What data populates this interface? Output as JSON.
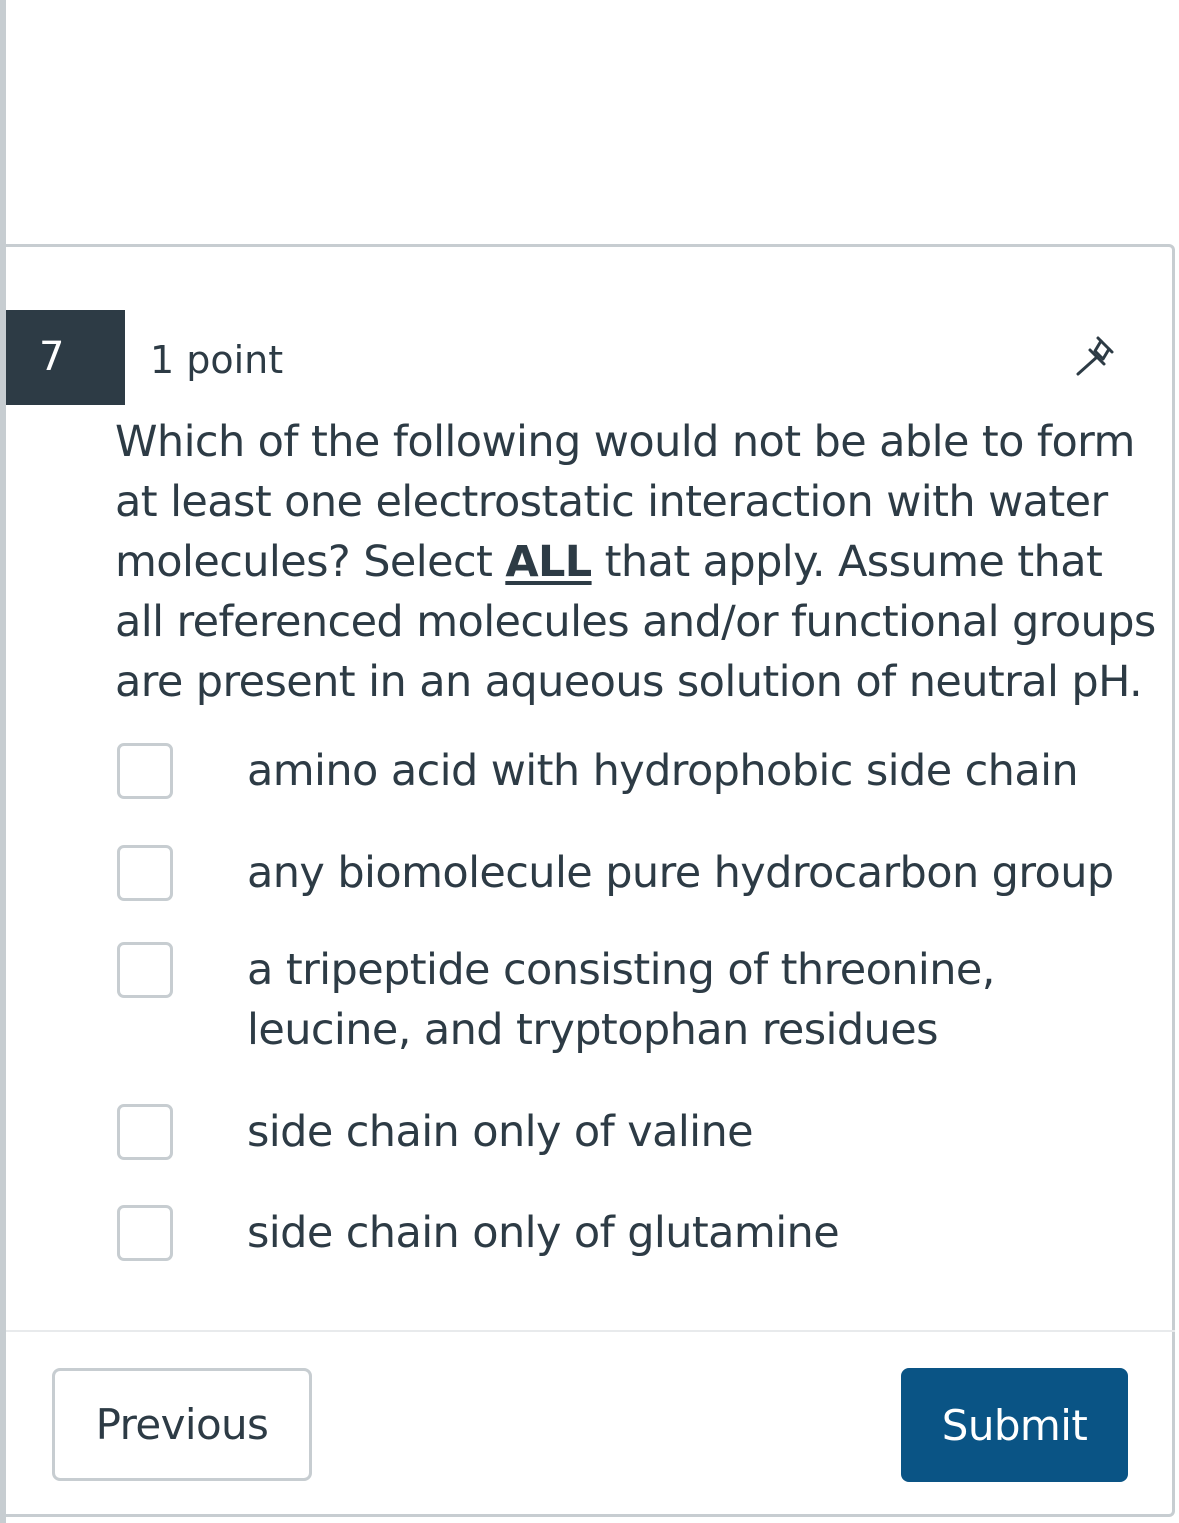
{
  "question": {
    "number": "7",
    "points": "1 point",
    "text_before": "Which of the following would not be able to form at least one electrostatic interaction with water molecules? Select ",
    "emphasis": "ALL",
    "text_after": " that apply. Assume that all referenced molecules and/or functional groups are present in an aqueous solution of neutral pH.",
    "pin_icon": "pin-icon"
  },
  "options": [
    {
      "label": "amino acid with hydrophobic side chain",
      "checked": false
    },
    {
      "label": "any biomolecule pure hydrocarbon group",
      "checked": false
    },
    {
      "label": "a tripeptide consisting of threonine, leucine, and tryptophan residues",
      "checked": false
    },
    {
      "label": "side chain only of valine",
      "checked": false
    },
    {
      "label": "side chain only of glutamine",
      "checked": false
    }
  ],
  "footer": {
    "previous_label": "Previous",
    "submit_label": "Submit"
  },
  "colors": {
    "number_badge_bg": "#2d3b45",
    "text": "#2d3b45",
    "border": "#c7cdd1",
    "submit_bg": "#0a5485"
  }
}
